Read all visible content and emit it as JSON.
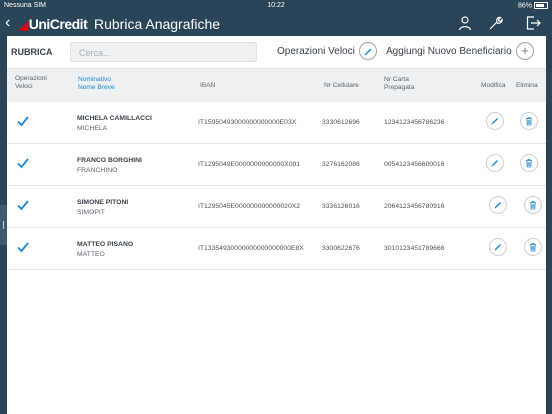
{
  "status_bar": {
    "carrier": "Nessuna SIM",
    "time": "10:22",
    "battery": "86%"
  },
  "header": {
    "logo": "UniCredit",
    "title": "Rubrica Anagrafiche"
  },
  "toolbar": {
    "section_label": "RUBRICA",
    "search_placeholder": "Cerca...",
    "quick_ops_label": "Operazioni Veloci",
    "add_beneficiary_label": "Aggiungi Nuovo Beneficiario"
  },
  "table": {
    "headers": {
      "quick_ops_1": "Operazioni",
      "quick_ops_2": "Veloci",
      "name_1": "Nominativo",
      "name_2": "Nome Breve",
      "iban": "IBAN",
      "cell": "Nr Cellulare",
      "card_1": "Nr Carta",
      "card_2": "Prepagata",
      "edit": "Modifica",
      "delete": "Elimina"
    },
    "rows": [
      {
        "name": "MICHELA CAMILLACCI",
        "short_name": "MICHELA",
        "iban": "IT15950493000000000000E03X",
        "cell": "3330612696",
        "card": "1234123456786236",
        "quick_op": true
      },
      {
        "name": "FRANCO BORGHINI",
        "short_name": "FRANCHINO",
        "iban": "IT1295049E0000000000000X001",
        "cell": "3276162086",
        "card": "0054123456600016",
        "quick_op": true
      },
      {
        "name": "SIMONE PITONI",
        "short_name": "SIMOPIT",
        "iban": "IT1295045E000000000000020X2",
        "cell": "3336126016",
        "card": "2064123456780916",
        "quick_op": true
      },
      {
        "name": "MATTEO PISANO",
        "short_name": "MATTEO",
        "iban": "IT13354930000000000000000E8X",
        "cell": "3300622676",
        "card": "3010123451789666",
        "quick_op": true
      }
    ]
  },
  "colors": {
    "header_bg": "#2a4458",
    "accent": "#1b8ad3",
    "brand_red": "#e2001a"
  },
  "icons": [
    "user-icon",
    "wrench-icon",
    "logout-icon",
    "pen-icon",
    "plus-icon",
    "check-icon",
    "edit-icon",
    "trash-icon"
  ]
}
